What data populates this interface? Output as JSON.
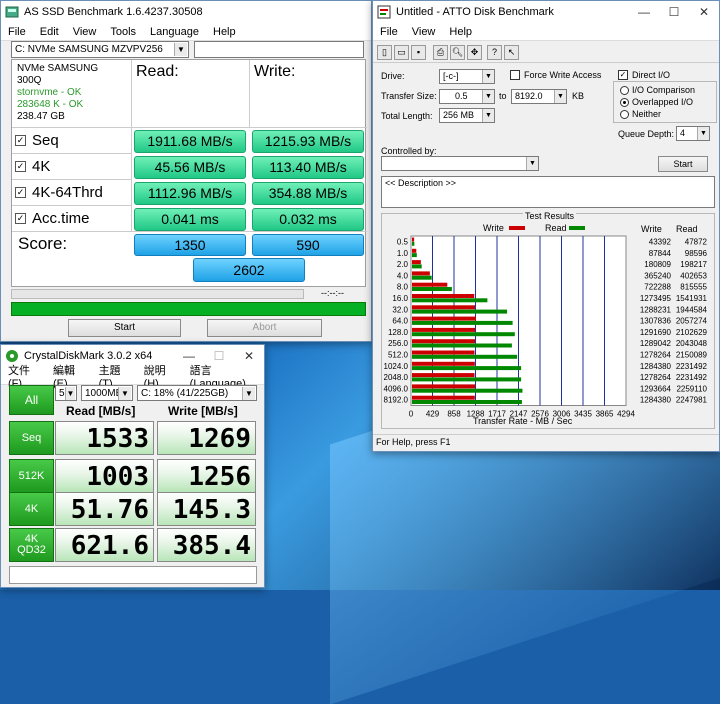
{
  "asssd": {
    "title": "AS SSD Benchmark 1.6.4237.30508",
    "menu": [
      "File",
      "Edit",
      "View",
      "Tools",
      "Language",
      "Help"
    ],
    "drive": "C: NVMe SAMSUNG MZVPV256",
    "info": {
      "model": "NVMe SAMSUNG",
      "fw": "300Q",
      "driver": "stornvme - OK",
      "align": "283648 K - OK",
      "size": "238.47 GB"
    },
    "read_hdr": "Read:",
    "write_hdr": "Write:",
    "rows": [
      {
        "label": "Seq",
        "read": "1911.68 MB/s",
        "write": "1215.93 MB/s"
      },
      {
        "label": "4K",
        "read": "45.56 MB/s",
        "write": "113.40 MB/s"
      },
      {
        "label": "4K-64Thrd",
        "read": "1112.96 MB/s",
        "write": "354.88 MB/s"
      },
      {
        "label": "Acc.time",
        "read": "0.041 ms",
        "write": "0.032 ms"
      }
    ],
    "score_label": "Score:",
    "score_read": "1350",
    "score_write": "590",
    "score_total": "2602",
    "time": "--:--:--",
    "start": "Start",
    "abort": "Abort"
  },
  "atto": {
    "title": "Untitled - ATTO Disk Benchmark",
    "menu": [
      "File",
      "View",
      "Help"
    ],
    "drive_label": "Drive:",
    "drive": "[-c-]",
    "force_write": "Force Write Access",
    "direct_io": "Direct I/O",
    "transfer_label": "Transfer Size:",
    "ts_from": "0.5",
    "to": "to",
    "ts_to": "8192.0",
    "kb": "KB",
    "length_label": "Total Length:",
    "length": "256 MB",
    "io_comp": "I/O Comparison",
    "overlapped": "Overlapped I/O",
    "neither": "Neither",
    "qd_label": "Queue Depth:",
    "qd": "4",
    "controlled": "Controlled by:",
    "start": "Start",
    "desc": "<< Description >>",
    "results_title": "Test Results",
    "write_lab": "Write",
    "read_lab": "Read",
    "col_write": "Write",
    "col_read": "Read",
    "xlabel": "Transfer Rate - MB / Sec",
    "status": "For Help, press F1",
    "colors": {
      "write": "#cc0000",
      "read": "#008800"
    }
  },
  "chart_data": {
    "type": "bar",
    "title": "Test Results",
    "xlabel": "Transfer Rate - MB / Sec",
    "categories": [
      "0.5",
      "1.0",
      "2.0",
      "4.0",
      "8.0",
      "16.0",
      "32.0",
      "64.0",
      "128.0",
      "256.0",
      "512.0",
      "1024.0",
      "2048.0",
      "4096.0",
      "8192.0"
    ],
    "xticks": [
      "0",
      "429",
      "858",
      "1288",
      "1717",
      "2147",
      "2576",
      "3006",
      "3435",
      "3865",
      "4294"
    ],
    "xlim": [
      0,
      4294
    ],
    "series": [
      {
        "name": "Write",
        "values_kb": [
          43392,
          87844,
          180809,
          365240,
          722288,
          1273495,
          1288231,
          1307836,
          1291690,
          1289042,
          1278264,
          1284380,
          1278264,
          1293664,
          1284380
        ]
      },
      {
        "name": "Read",
        "values_kb": [
          47872,
          98596,
          198217,
          402653,
          815555,
          1541931,
          1944584,
          2057274,
          2102629,
          2043048,
          2150089,
          2231492,
          2231492,
          2259110,
          2247981
        ]
      }
    ]
  },
  "cdm": {
    "title": "CrystalDiskMark 3.0.2 x64",
    "menu": [
      "文件(F)",
      "編輯(E)",
      "主題(T)",
      "說明(H)",
      "語言(Language)"
    ],
    "all": "All",
    "passes": "5",
    "size": "1000MB",
    "drive": "C: 18% (41/225GB)",
    "read_hdr": "Read [MB/s]",
    "write_hdr": "Write [MB/s]",
    "rows": [
      {
        "label": "Seq",
        "sub": "",
        "read": "1533",
        "write": "1269"
      },
      {
        "label": "512K",
        "sub": "",
        "read": "1003",
        "write": "1256"
      },
      {
        "label": "4K",
        "sub": "",
        "read": "51.76",
        "write": "145.3"
      },
      {
        "label": "4K",
        "sub": "QD32",
        "read": "621.6",
        "write": "385.4"
      }
    ]
  }
}
